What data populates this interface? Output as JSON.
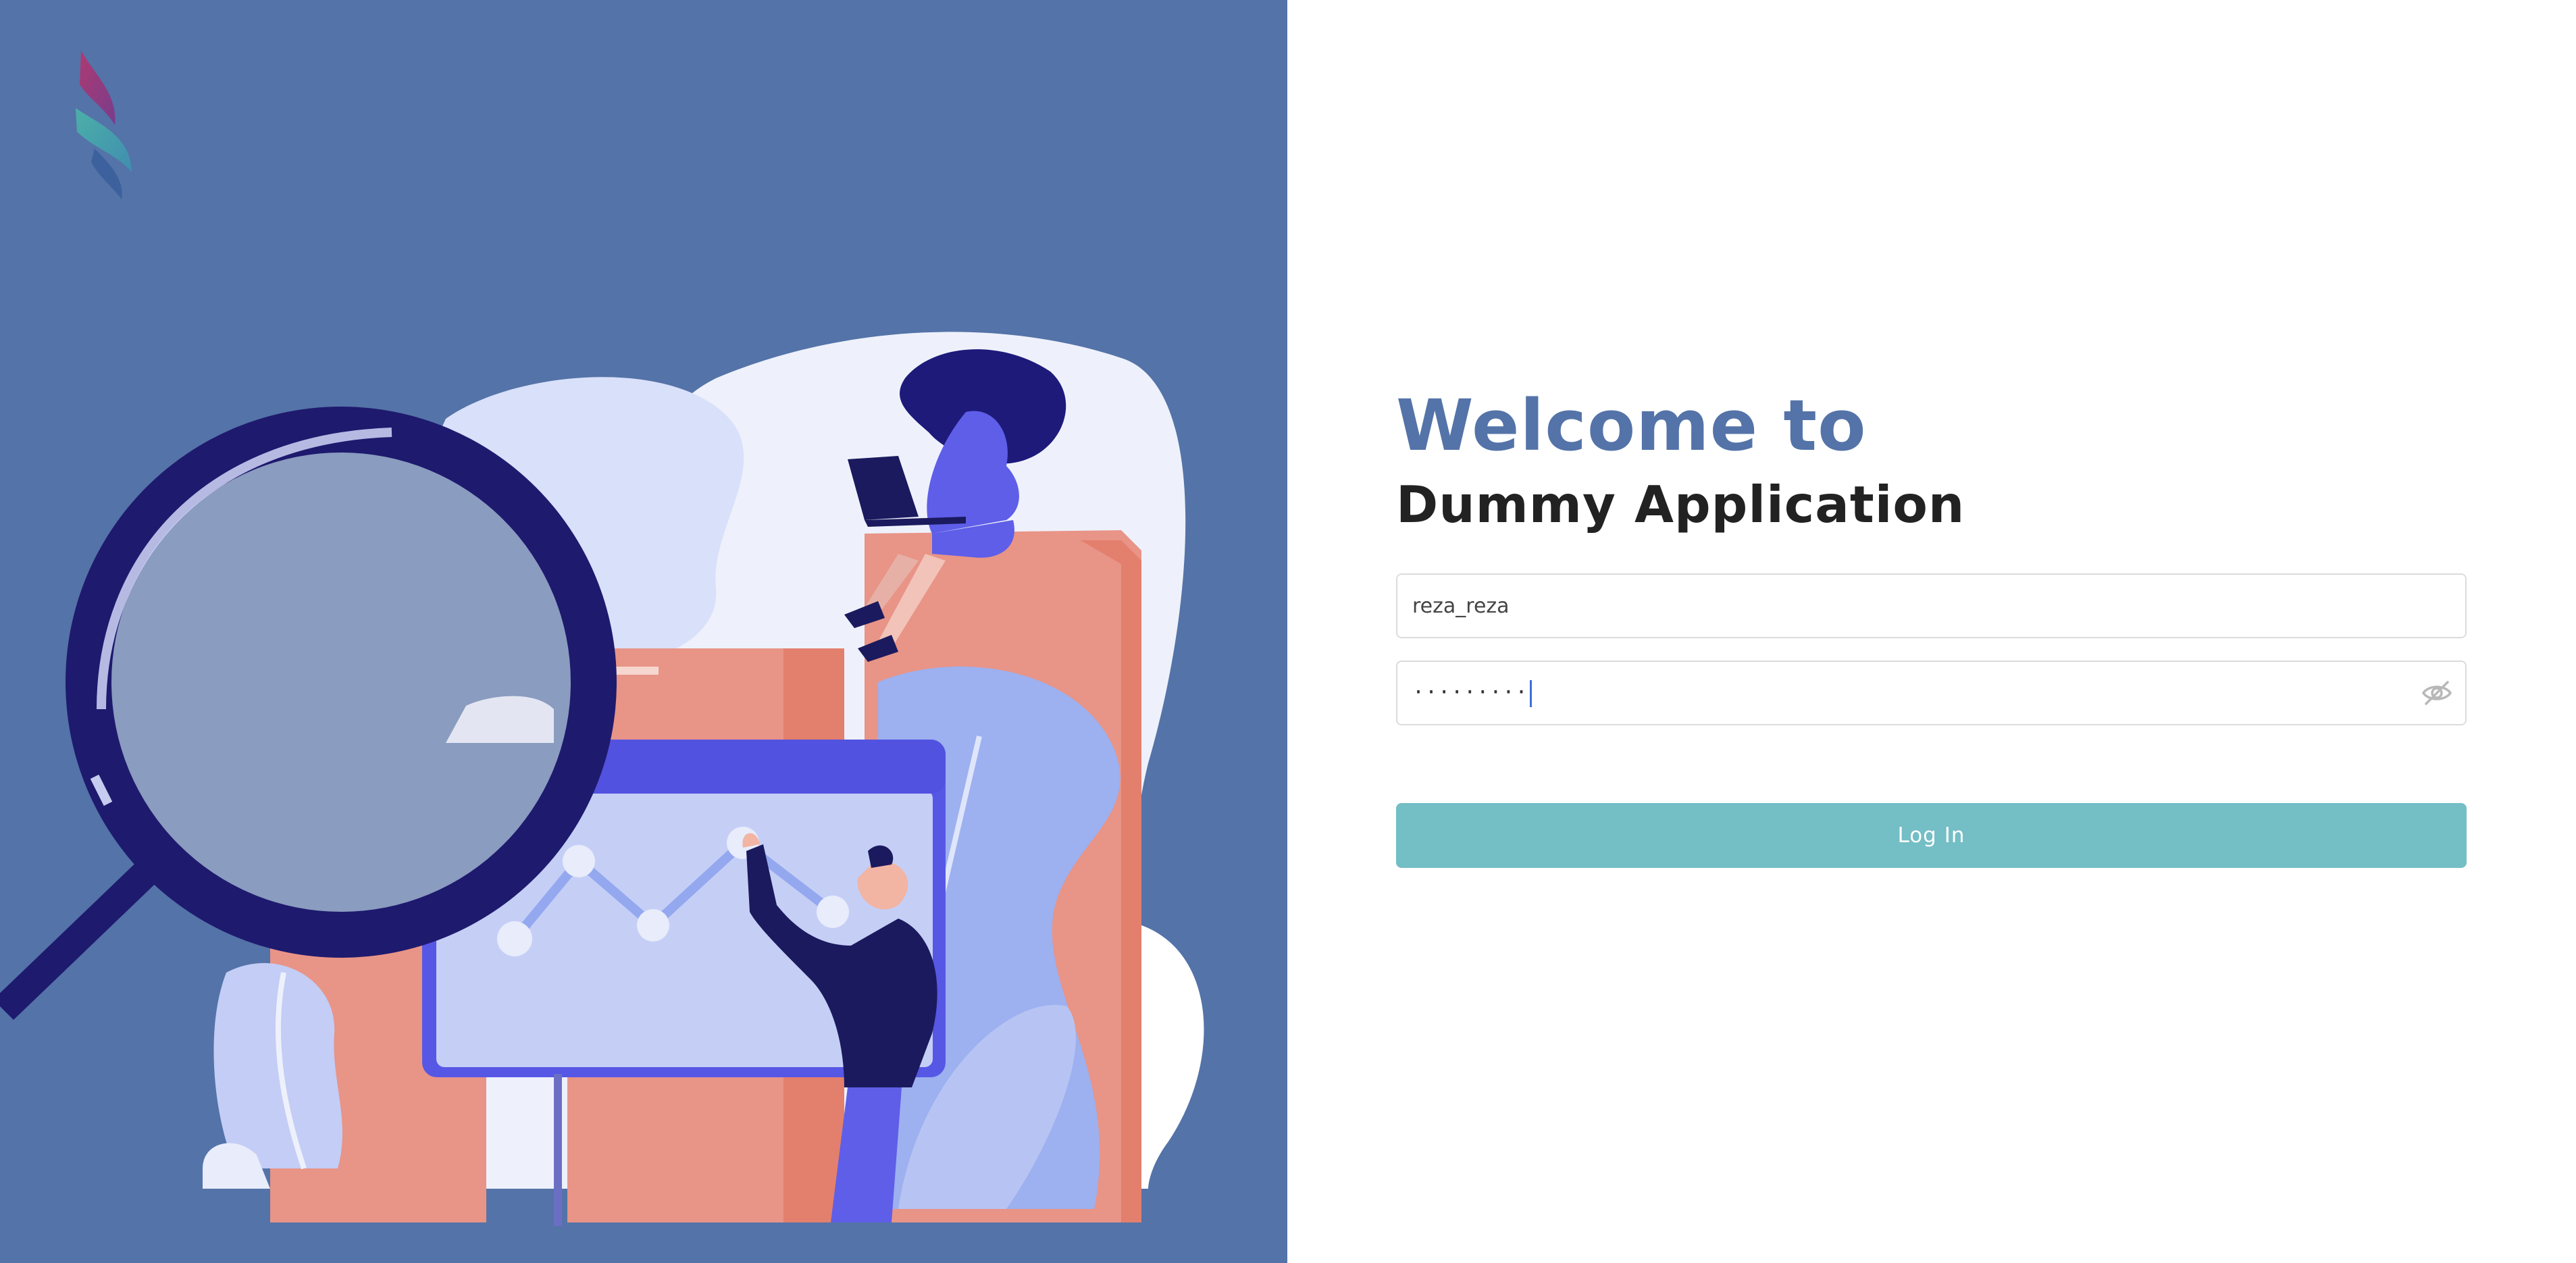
{
  "left_panel": {
    "logo_icon": "flame-logo-icon",
    "illustration": "data-analysis-illustration"
  },
  "login": {
    "title": "Welcome to",
    "subtitle": "Dummy Application",
    "username_value": "reza_reza",
    "password_masked": "·········",
    "visibility_icon": "eye-slash-icon",
    "submit_label": "Log In"
  },
  "colors": {
    "left_background": "#5473a8",
    "title": "#5473a8",
    "subtitle": "#222222",
    "button": "#74bec6",
    "button_text": "#ffffff"
  }
}
